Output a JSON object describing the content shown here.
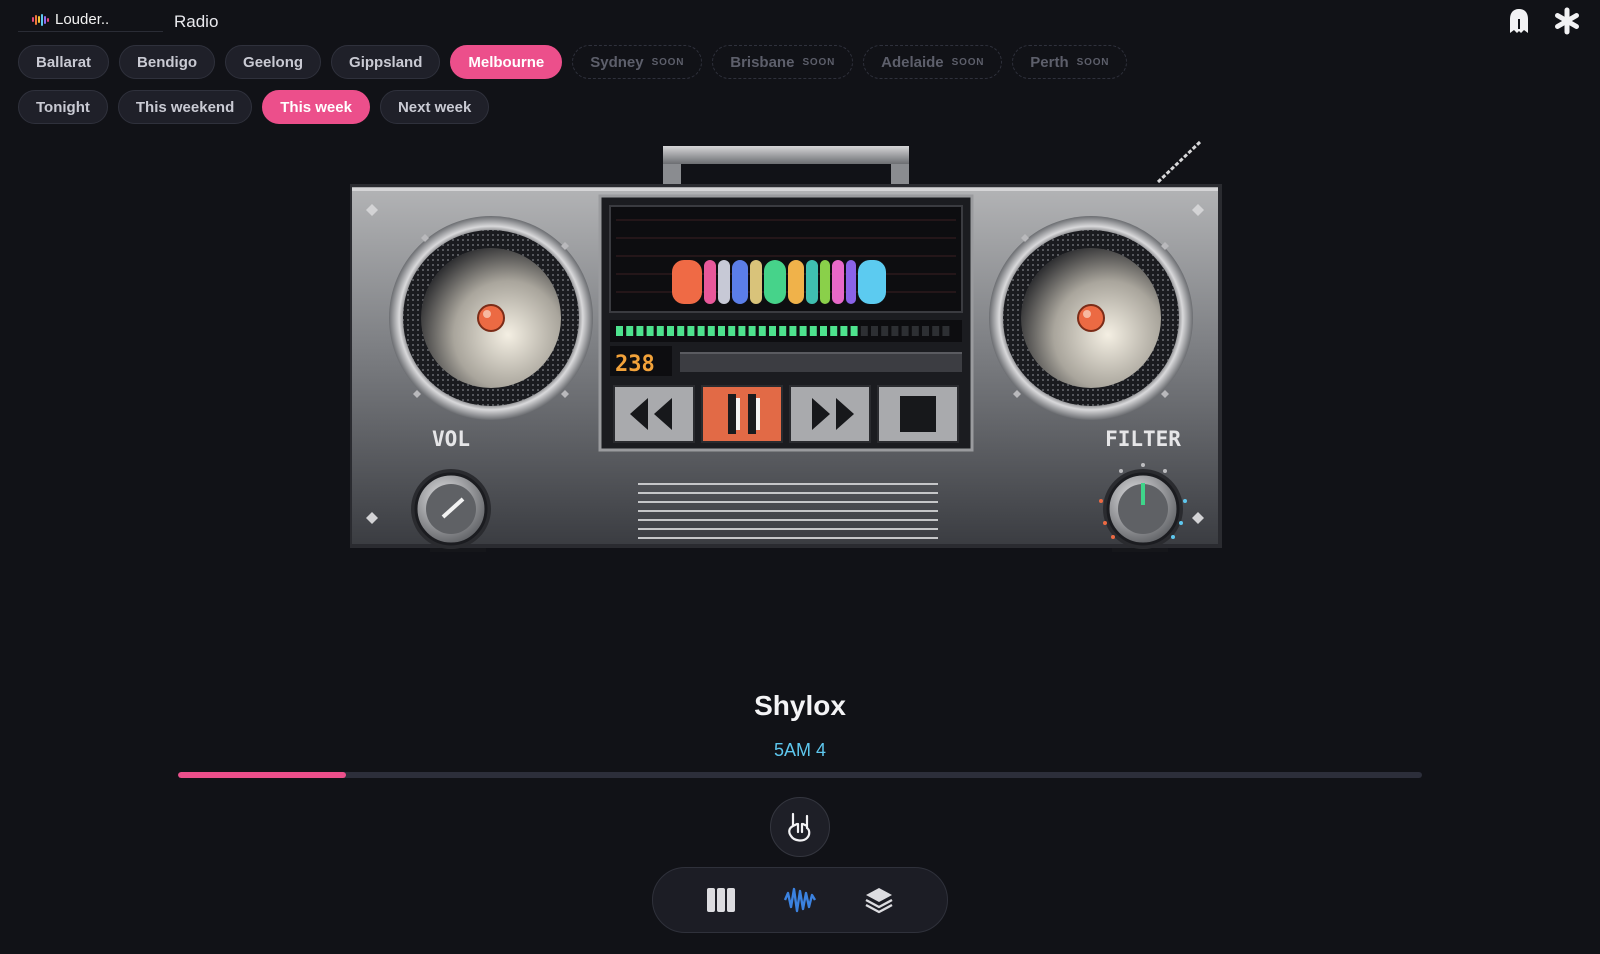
{
  "app": {
    "brand": "Louder..",
    "section": "Radio"
  },
  "colors": {
    "accent": "#ec4f8b",
    "track": "#5ec7ee",
    "background": "#111217"
  },
  "regions": [
    {
      "label": "Ballarat",
      "state": "normal"
    },
    {
      "label": "Bendigo",
      "state": "normal"
    },
    {
      "label": "Geelong",
      "state": "normal"
    },
    {
      "label": "Gippsland",
      "state": "normal"
    },
    {
      "label": "Melbourne",
      "state": "active"
    },
    {
      "label": "Sydney",
      "state": "disabled",
      "badge": "SOON"
    },
    {
      "label": "Brisbane",
      "state": "disabled",
      "badge": "SOON"
    },
    {
      "label": "Adelaide",
      "state": "disabled",
      "badge": "SOON"
    },
    {
      "label": "Perth",
      "state": "disabled",
      "badge": "SOON"
    }
  ],
  "timeframes": [
    {
      "label": "Tonight",
      "state": "normal"
    },
    {
      "label": "This weekend",
      "state": "normal"
    },
    {
      "label": "This week",
      "state": "active"
    },
    {
      "label": "Next week",
      "state": "normal"
    }
  ],
  "player": {
    "counter": "238",
    "vol_label": "VOL",
    "filter_label": "FILTER",
    "level_lit": 24,
    "level_total": 33,
    "controls": [
      "rewind-icon",
      "pause-icon",
      "fast-forward-icon",
      "stop-icon"
    ]
  },
  "now_playing": {
    "artist": "Shylox",
    "track": "5AM 4",
    "progress": 0.135
  },
  "icons": {
    "top": [
      "ghost-icon",
      "asterisk-icon"
    ],
    "reaction": "rock-hand-icon",
    "nav": [
      "columns-icon",
      "waveform-icon",
      "layers-icon"
    ]
  }
}
